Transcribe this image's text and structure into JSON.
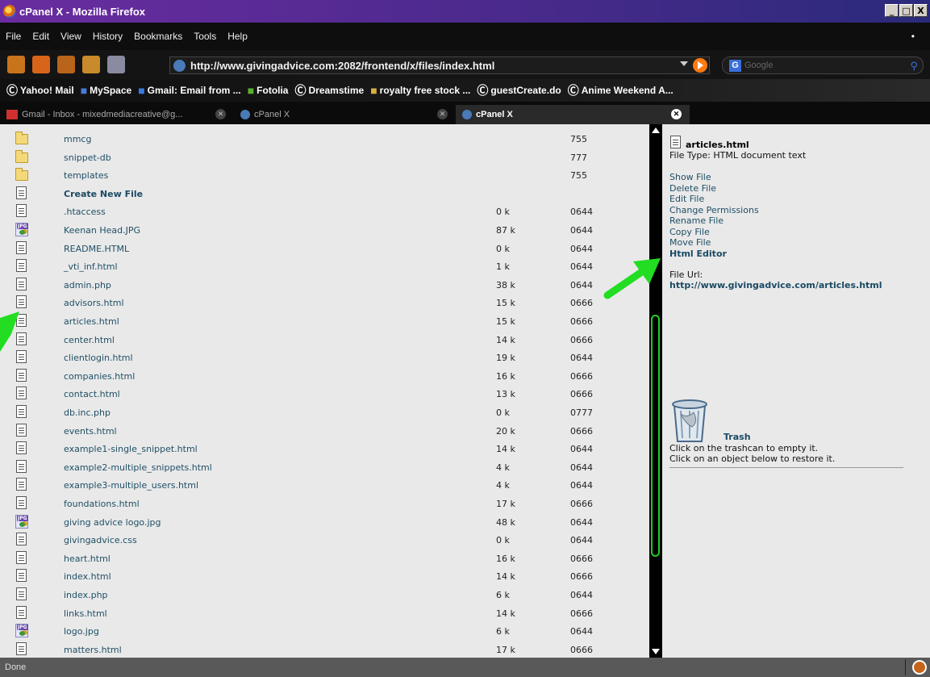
{
  "window": {
    "title": "cPanel X - Mozilla Firefox",
    "min": "_",
    "max": "□",
    "close": "X"
  },
  "menu": [
    "File",
    "Edit",
    "View",
    "History",
    "Bookmarks",
    "Tools",
    "Help"
  ],
  "nav": {
    "url": "http://www.givingadvice.com:2082/frontend/x/files/index.html",
    "search_placeholder": "Google",
    "search_engine_letter": "G"
  },
  "bookmarks": [
    {
      "icon": "yahoo-icon",
      "label": "Yahoo! Mail"
    },
    {
      "icon": "myspace-icon",
      "label": "MySpace"
    },
    {
      "icon": "gmail-icon",
      "label": "Gmail: Email from ..."
    },
    {
      "icon": "fotolia-icon",
      "label": "Fotolia"
    },
    {
      "icon": "dreamstime-icon",
      "label": "Dreamstime"
    },
    {
      "icon": "folder-icon",
      "label": "royalty free stock ..."
    },
    {
      "icon": "bookmark-icon",
      "label": "guestCreate.do"
    },
    {
      "icon": "bookmark-icon",
      "label": "Anime Weekend A..."
    }
  ],
  "tabs": [
    {
      "label": "Gmail - Inbox - mixedmediacreative@g...",
      "icon": "gmail-icon",
      "active": false
    },
    {
      "label": "cPanel X",
      "icon": "cpanel-icon",
      "active": false
    },
    {
      "label": "cPanel X",
      "icon": "cpanel-icon",
      "active": true
    }
  ],
  "files": [
    {
      "type": "folder",
      "name": "mmcg",
      "size": "",
      "perm": "755"
    },
    {
      "type": "folder",
      "name": "snippet-db",
      "size": "",
      "perm": "777"
    },
    {
      "type": "folder",
      "name": "templates",
      "size": "",
      "perm": "755"
    },
    {
      "type": "doc",
      "name": "Create New File",
      "size": "",
      "perm": "",
      "bold": true
    },
    {
      "type": "doc",
      "name": ".htaccess",
      "size": "0 k",
      "perm": "0644"
    },
    {
      "type": "jpg",
      "name": "Keenan Head.JPG",
      "size": "87 k",
      "perm": "0644"
    },
    {
      "type": "doc",
      "name": "README.HTML",
      "size": "0 k",
      "perm": "0644"
    },
    {
      "type": "doc",
      "name": "_vti_inf.html",
      "size": "1 k",
      "perm": "0644"
    },
    {
      "type": "doc",
      "name": "admin.php",
      "size": "38 k",
      "perm": "0644"
    },
    {
      "type": "doc",
      "name": "advisors.html",
      "size": "15 k",
      "perm": "0666"
    },
    {
      "type": "doc",
      "name": "articles.html",
      "size": "15 k",
      "perm": "0666"
    },
    {
      "type": "doc",
      "name": "center.html",
      "size": "14 k",
      "perm": "0666"
    },
    {
      "type": "doc",
      "name": "clientlogin.html",
      "size": "19 k",
      "perm": "0644"
    },
    {
      "type": "doc",
      "name": "companies.html",
      "size": "16 k",
      "perm": "0666"
    },
    {
      "type": "doc",
      "name": "contact.html",
      "size": "13 k",
      "perm": "0666"
    },
    {
      "type": "doc",
      "name": "db.inc.php",
      "size": "0 k",
      "perm": "0777"
    },
    {
      "type": "doc",
      "name": "events.html",
      "size": "20 k",
      "perm": "0666"
    },
    {
      "type": "doc",
      "name": "example1-single_snippet.html",
      "size": "14 k",
      "perm": "0644"
    },
    {
      "type": "doc",
      "name": "example2-multiple_snippets.html",
      "size": "4 k",
      "perm": "0644"
    },
    {
      "type": "doc",
      "name": "example3-multiple_users.html",
      "size": "4 k",
      "perm": "0644"
    },
    {
      "type": "doc",
      "name": "foundations.html",
      "size": "17 k",
      "perm": "0666"
    },
    {
      "type": "jpg",
      "name": "giving advice logo.jpg",
      "size": "48 k",
      "perm": "0644"
    },
    {
      "type": "doc",
      "name": "givingadvice.css",
      "size": "0 k",
      "perm": "0644"
    },
    {
      "type": "doc",
      "name": "heart.html",
      "size": "16 k",
      "perm": "0666"
    },
    {
      "type": "doc",
      "name": "index.html",
      "size": "14 k",
      "perm": "0666"
    },
    {
      "type": "doc",
      "name": "index.php",
      "size": "6 k",
      "perm": "0644"
    },
    {
      "type": "doc",
      "name": "links.html",
      "size": "14 k",
      "perm": "0666"
    },
    {
      "type": "jpg",
      "name": "logo.jpg",
      "size": "6 k",
      "perm": "0644"
    },
    {
      "type": "doc",
      "name": "matters.html",
      "size": "17 k",
      "perm": "0666"
    }
  ],
  "panel": {
    "filename": "articles.html",
    "filetype": "File Type: HTML document text",
    "actions": [
      "Show File",
      "Delete File",
      "Edit File",
      "Change Permissions",
      "Rename File",
      "Copy File",
      "Move File"
    ],
    "html_editor": "Html Editor",
    "file_url_label": "File Url:",
    "file_url": "http://www.givingadvice.com/articles.html",
    "trash_label": "Trash",
    "trash_line1": "Click on the trashcan to empty it.",
    "trash_line2": "Click on an object below to restore it."
  },
  "status": "Done",
  "colors": {
    "annotation_arrow": "#22dd22",
    "link": "#1f4f66"
  }
}
